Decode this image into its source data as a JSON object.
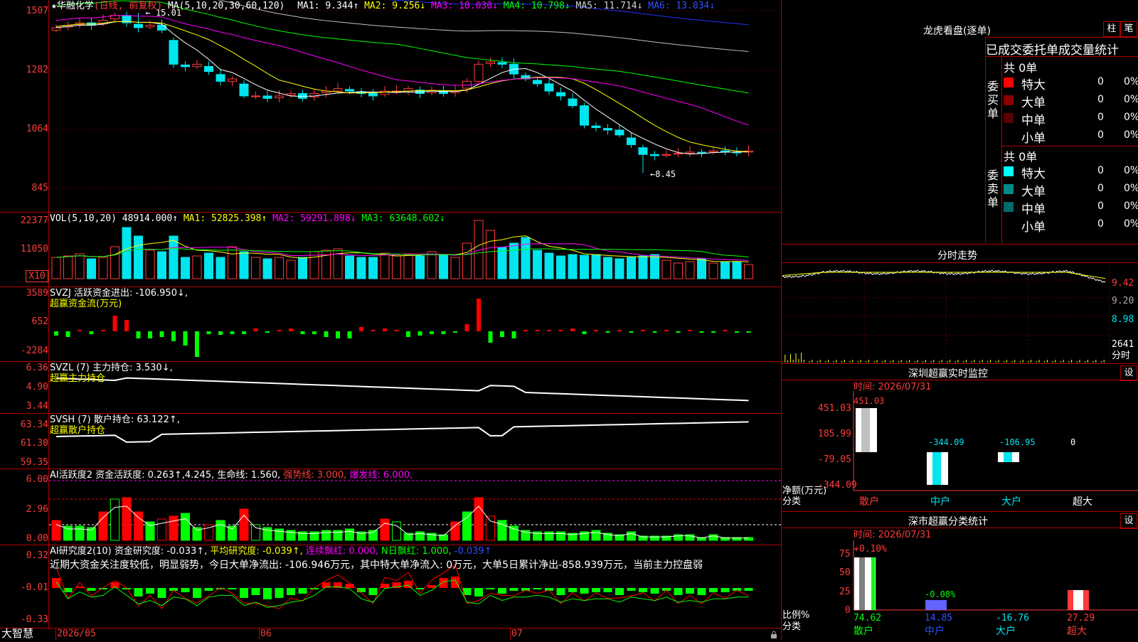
{
  "app_name": "大智慧",
  "colors": {
    "up": "#ff3b3b",
    "down": "#00e5ee",
    "bg": "#000000",
    "grid": "#b00000",
    "ma1": "#ffffff",
    "ma2": "#ffff00",
    "ma3": "#ff00ff",
    "ma4": "#00ff00",
    "ma5": "#c0c0c0",
    "ma6": "#0000ff",
    "green": "#00ff00"
  },
  "main": {
    "stock_name": "华融化学",
    "period": "(日线, 前复权)",
    "ma_title": "MA(5,10,20,30,60,120)",
    "ma1": "MA1: 9.344↑",
    "ma2": "MA2: 9.256↓",
    "ma3": "MA3: 10.030↓",
    "ma4": "MA4: 10.798↓",
    "ma5": "MA5: 11.714↓",
    "ma6": "MA6: 13.034↓",
    "y_labels": [
      "1507",
      "1282",
      "1064",
      "845"
    ],
    "high_mark": "15.01",
    "low_mark": "8.45",
    "star": "★"
  },
  "vol": {
    "title": "VOL(5,10,20)",
    "value": "48914.000↑",
    "ma1": "MA1: 52825.398↑",
    "ma2": "MA2: 59291.898↓",
    "ma3": "MA3: 63648.602↓",
    "y_labels": [
      "22377",
      "11050"
    ],
    "unit": "X10"
  },
  "svzj": {
    "title": "SVZJ  活跃资金进出: -106.950↓,",
    "subtitle": "超赢资金流(万元)",
    "y_labels": [
      "3589",
      "652",
      "-2284"
    ]
  },
  "svzl": {
    "title": "SVZL (7) 主力持仓: 3.530↓,",
    "subtitle": "超赢主力持仓",
    "y_labels": [
      "6.36",
      "4.90",
      "3.44"
    ]
  },
  "svsh": {
    "title": "SVSH (7) 散户持仓: 63.122↑,",
    "subtitle": "超赢散户持仓",
    "y_labels": [
      "63.34",
      "61.30",
      "59.35"
    ]
  },
  "ai1": {
    "title": "AI活跃度2 资金活跃度: 0.263↑,4.245,",
    "life": "生命线: 1.560,",
    "strong": "强势线: 3.000,",
    "burst": "爆发线: 6.000,",
    "y_labels": [
      "6.00",
      "2.96",
      "0.00"
    ]
  },
  "ai2": {
    "title": "AI研究度2(10) 资金研究度: -0.033↑,",
    "avg": "平均研究度: -0.039↑,",
    "cont": "连续飘红: 0.000,",
    "nday": "N日飘红: 1.000,",
    "tail": "-0.039↑",
    "comment": "近期大资金关注度较低，明显弱势，今日大单净流出: -106.946万元，其中特大单净流入: 0万元，大单5日累计净出-858.939万元，当前主力控盘弱",
    "y_labels": [
      "0.32",
      "-0.01",
      "-0.33"
    ]
  },
  "xaxis": {
    "labels": [
      "2026/05",
      "06",
      "07"
    ]
  },
  "right": {
    "lhb_title": "龙虎看盘(逐单)",
    "btn_zhu": "柱",
    "btn_bi": "笔",
    "stat_title": "已成交委托单成交量统计",
    "buy_label": "委买单",
    "sell_label": "委卖单",
    "buy_total": "共 0单",
    "sell_total": "共 0单",
    "rows": [
      {
        "name": "特大",
        "count": "0",
        "pct": "0%"
      },
      {
        "name": "大单",
        "count": "0",
        "pct": "0%"
      },
      {
        "name": "中单",
        "count": "0",
        "pct": "0%"
      },
      {
        "name": "小单",
        "count": "0",
        "pct": "0%"
      }
    ],
    "rows_sell": [
      {
        "name": "特大",
        "count": "0",
        "pct": "0%"
      },
      {
        "name": "大单",
        "count": "0",
        "pct": "0%"
      },
      {
        "name": "中单",
        "count": "0",
        "pct": "0%"
      },
      {
        "name": "小单",
        "count": "0",
        "pct": "0%"
      }
    ],
    "fenshi_title": "分时走势",
    "fenshi_y": [
      "9.42",
      "9.20",
      "8.98"
    ],
    "fenshi_vol": "2641",
    "fenshi_vol_label": "分时",
    "sz_title": "深圳超赢实时监控",
    "sz_btn": "设",
    "sz_time": "时间: 2026/07/31",
    "sz_y": [
      "451.03",
      "185.99",
      "-79.05",
      "-344.09"
    ],
    "sz_values": [
      {
        "name": "散户",
        "value": "451.03"
      },
      {
        "name": "中户",
        "value": "-344.09"
      },
      {
        "name": "大户",
        "value": "-106.95"
      },
      {
        "name": "超大",
        "value": "0"
      }
    ],
    "sz_ylabel": "净额(万元)",
    "sz_xlabel": "分类",
    "cls_title": "深市超赢分类统计",
    "cls_btn": "设",
    "cls_time": "时间: 2026/07/31",
    "cls_top": "+0.10%",
    "cls_mid": "-0.08%",
    "cls_y": [
      "75",
      "50",
      "25",
      "0"
    ],
    "cls_values": [
      {
        "name": "散户",
        "value": "74.62"
      },
      {
        "name": "中户",
        "value": "14.85"
      },
      {
        "name": "大户",
        "value": "-16.76"
      },
      {
        "name": "超大",
        "value": "27.29"
      }
    ],
    "cls_ylabel": "比例%",
    "cls_xlabel": "分类"
  }
}
